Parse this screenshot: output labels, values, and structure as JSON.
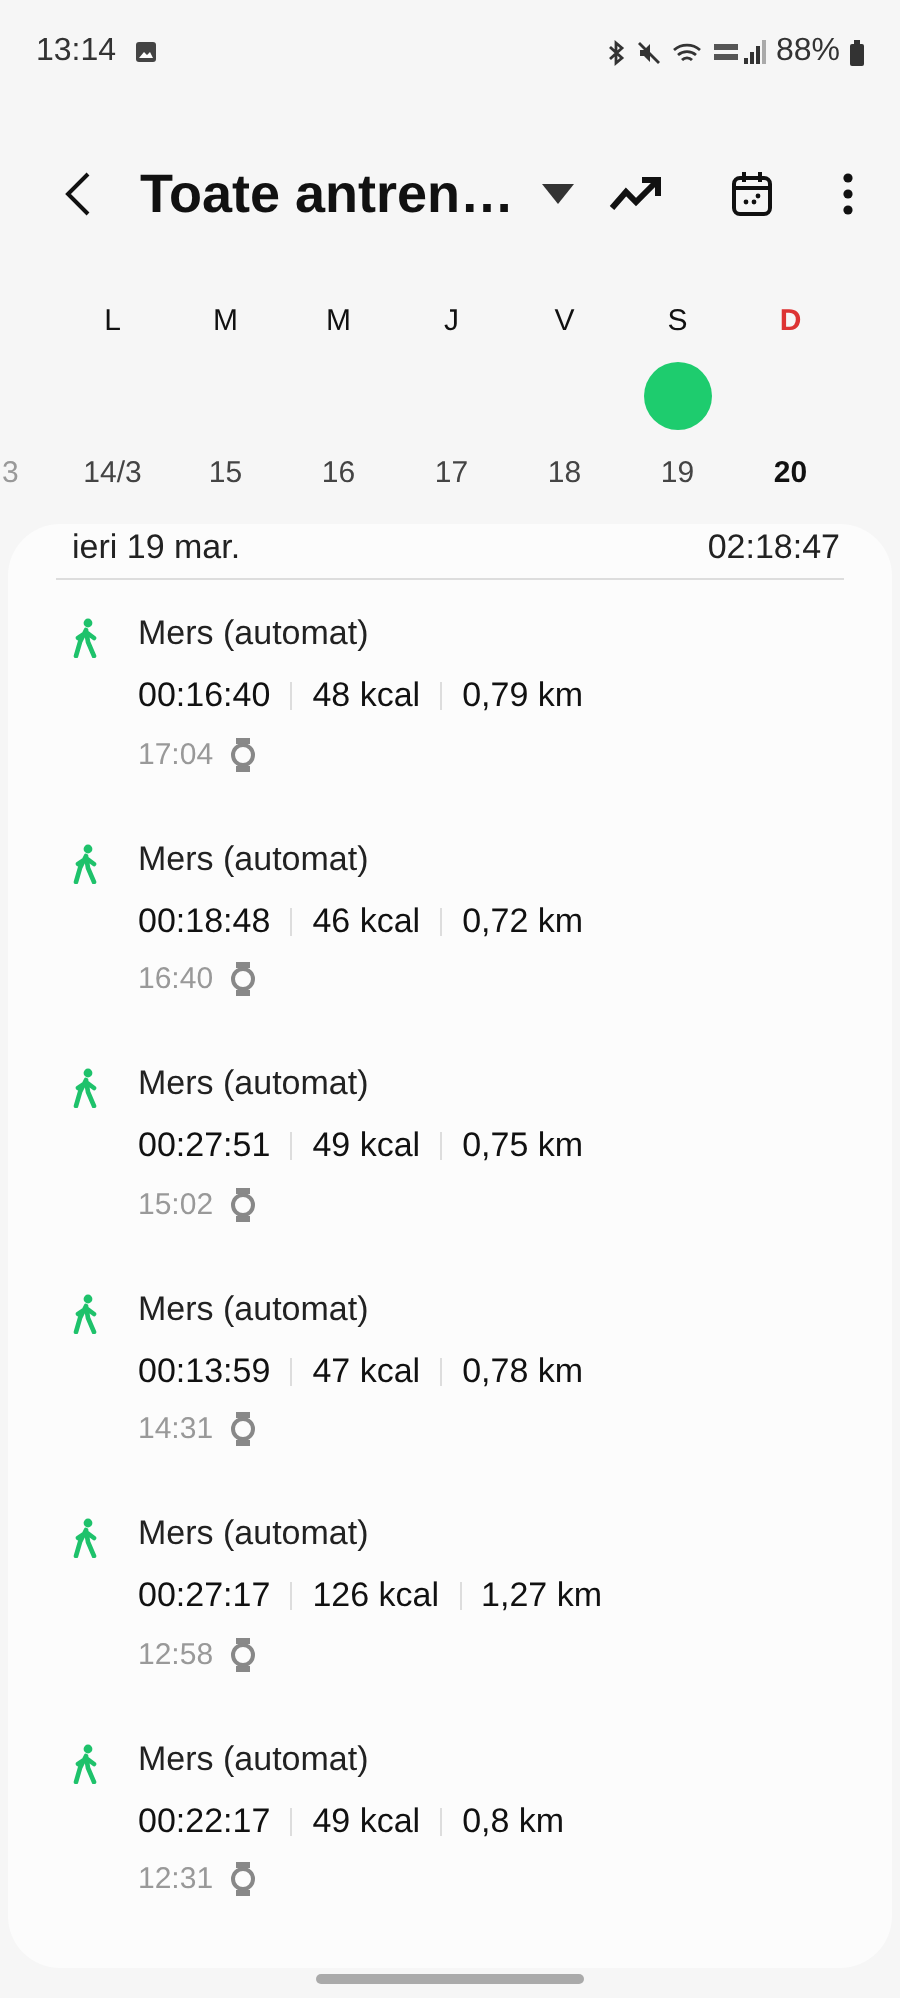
{
  "status_bar": {
    "time": "13:14",
    "battery": "88%"
  },
  "toolbar": {
    "title": "Toate antren…"
  },
  "week": {
    "days": [
      {
        "label": "L",
        "weekend": false
      },
      {
        "label": "M",
        "weekend": false
      },
      {
        "label": "M",
        "weekend": false
      },
      {
        "label": "J",
        "weekend": false
      },
      {
        "label": "V",
        "weekend": false
      },
      {
        "label": "S",
        "weekend": false
      },
      {
        "label": "D",
        "weekend": true
      }
    ],
    "previous_date": "3",
    "dates": [
      {
        "label": "14/3",
        "selected": false,
        "activity": false
      },
      {
        "label": "15",
        "selected": false,
        "activity": false
      },
      {
        "label": "16",
        "selected": false,
        "activity": false
      },
      {
        "label": "17",
        "selected": false,
        "activity": false
      },
      {
        "label": "18",
        "selected": false,
        "activity": false
      },
      {
        "label": "19",
        "selected": false,
        "activity": true
      },
      {
        "label": "20",
        "selected": true,
        "activity": false
      }
    ]
  },
  "day_header": {
    "date": "ieri 19 mar.",
    "total": "02:18:47"
  },
  "workouts": [
    {
      "name": "Mers (automat)",
      "duration": "00:16:40",
      "calories": "48 kcal",
      "distance": "0,79 km",
      "time": "17:04"
    },
    {
      "name": "Mers (automat)",
      "duration": "00:18:48",
      "calories": "46 kcal",
      "distance": "0,72 km",
      "time": "16:40"
    },
    {
      "name": "Mers (automat)",
      "duration": "00:27:51",
      "calories": "49 kcal",
      "distance": "0,75 km",
      "time": "15:02"
    },
    {
      "name": "Mers (automat)",
      "duration": "00:13:59",
      "calories": "47 kcal",
      "distance": "0,78 km",
      "time": "14:31"
    },
    {
      "name": "Mers (automat)",
      "duration": "00:27:17",
      "calories": "126 kcal",
      "distance": "1,27 km",
      "time": "12:58"
    },
    {
      "name": "Mers (automat)",
      "duration": "00:22:17",
      "calories": "49 kcal",
      "distance": "0,8 km",
      "time": "12:31"
    }
  ]
}
